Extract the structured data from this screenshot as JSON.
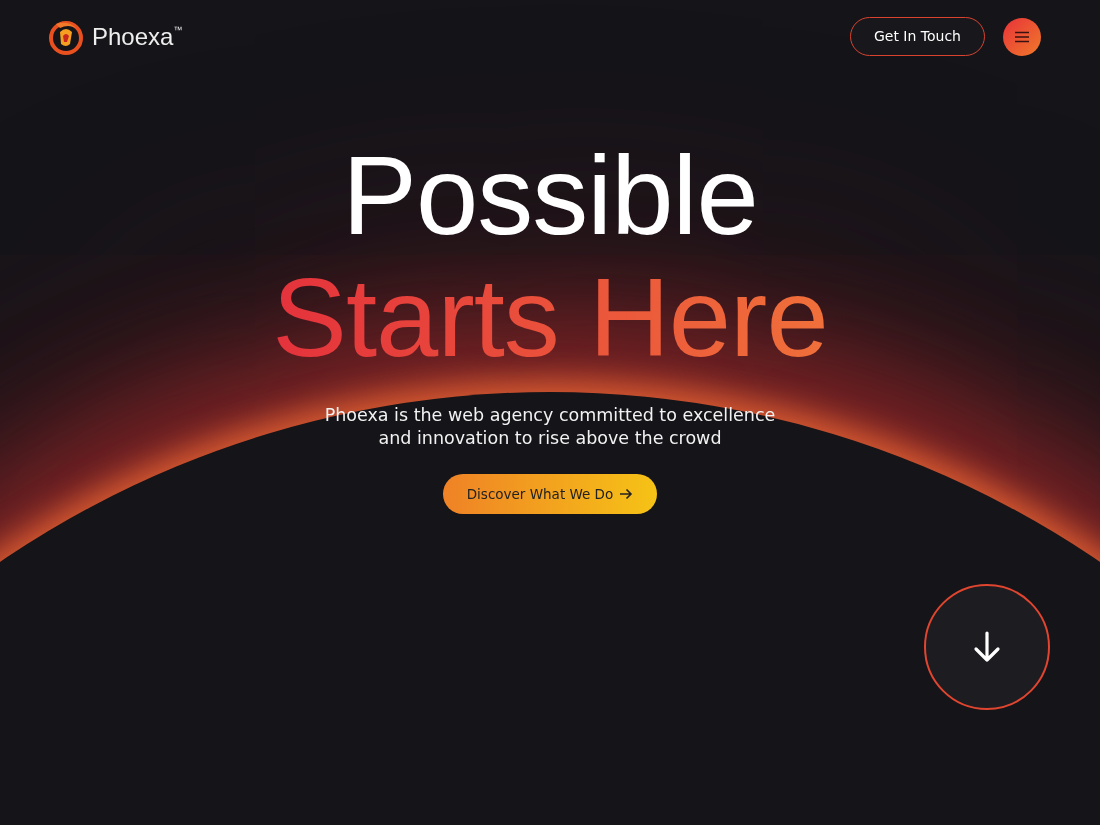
{
  "header": {
    "brand": "Phoexa$^{™}$",
    "contact_button": "Get In Touch"
  },
  "hero": {
    "title_line_1": "Possible",
    "title_line_2": "Starts Here",
    "subtitle_line_1": "Phoexa is the web agency committed to excellence",
    "subtitle_line_2": "and innovation to rise above the crowd",
    "cta_button": "Discover What We Do"
  }
}
